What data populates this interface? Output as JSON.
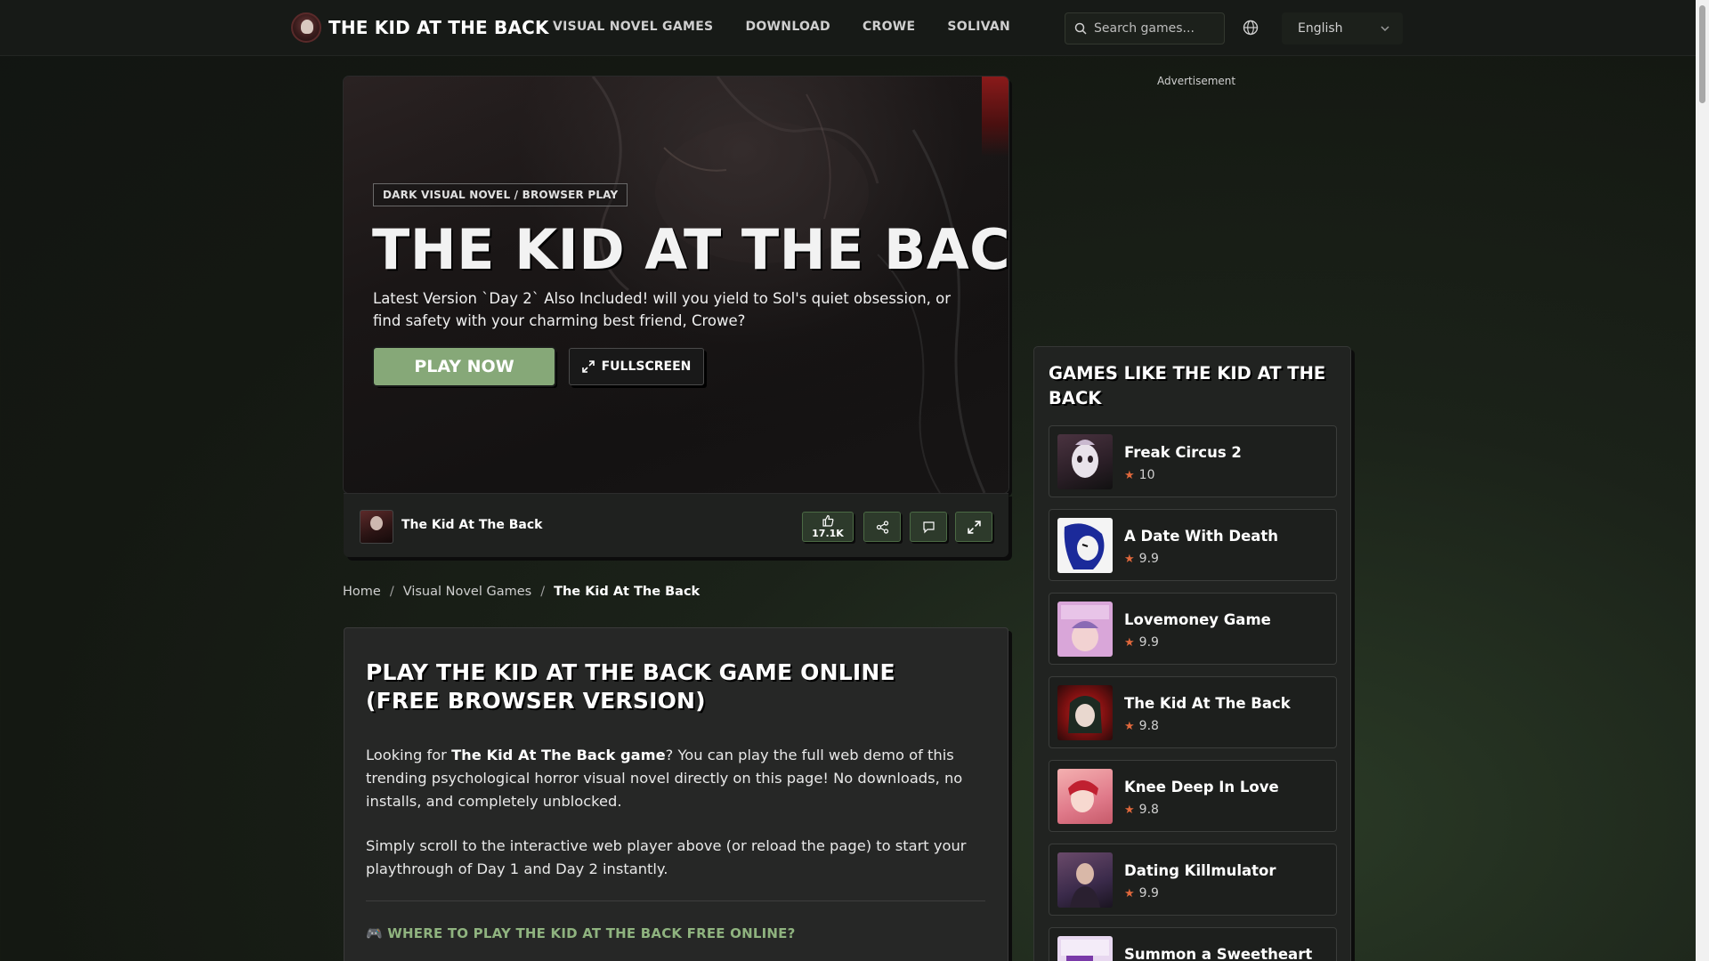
{
  "header": {
    "brand": "THE KID AT THE BACK",
    "nav": [
      "VISUAL NOVEL GAMES",
      "DOWNLOAD",
      "CROWE",
      "SOLIVAN"
    ],
    "search_placeholder": "Search games...",
    "language": "English"
  },
  "hero": {
    "tag": "DARK VISUAL NOVEL / BROWSER PLAY",
    "title": "THE KID AT THE BACK",
    "description": "Latest Version `Day 2` Also Included! will you yield to Sol's quiet obsession, or find safety with your charming best friend, Crowe?",
    "play_label": "PLAY NOW",
    "fullscreen_label": "FULLSCREEN"
  },
  "player_bar": {
    "game_name": "The Kid At The Back",
    "likes": "17.1K"
  },
  "breadcrumb": {
    "home": "Home",
    "category": "Visual Novel Games",
    "current": "The Kid At The Back"
  },
  "content": {
    "title": "PLAY THE KID AT THE BACK GAME ONLINE (FREE BROWSER VERSION)",
    "p1_before": "Looking for ",
    "p1_bold": "The Kid At The Back game",
    "p1_after": "? You can play the full web demo of this trending psychological horror visual novel directly on this page! No downloads, no installs, and completely unblocked.",
    "p2": "Simply scroll to the interactive web player above (or reload the page) to start your playthrough of Day 1 and Day 2 instantly.",
    "h3": "🎮 WHERE TO PLAY THE KID AT THE BACK FREE ONLINE?"
  },
  "ad": {
    "label": "Advertisement"
  },
  "sidebar": {
    "title": "GAMES LIKE THE KID AT THE BACK",
    "games": [
      {
        "name": "Freak Circus 2",
        "rating": "10"
      },
      {
        "name": "A Date With Death",
        "rating": "9.9"
      },
      {
        "name": "Lovemoney Game",
        "rating": "9.9"
      },
      {
        "name": "The Kid At The Back",
        "rating": "9.8"
      },
      {
        "name": "Knee Deep In Love",
        "rating": "9.8"
      },
      {
        "name": "Dating Killmulator",
        "rating": "9.9"
      },
      {
        "name": "Summon a Sweetheart",
        "rating": ""
      }
    ]
  },
  "colors": {
    "accent_green": "#86a878",
    "link_green": "#8fb37f",
    "star": "#e0683c"
  },
  "icons": [
    "search-icon",
    "globe-icon",
    "chevron-down-icon",
    "expand-icon",
    "thumbs-up-icon",
    "share-icon",
    "comment-icon",
    "fullscreen-icon",
    "star-icon"
  ]
}
